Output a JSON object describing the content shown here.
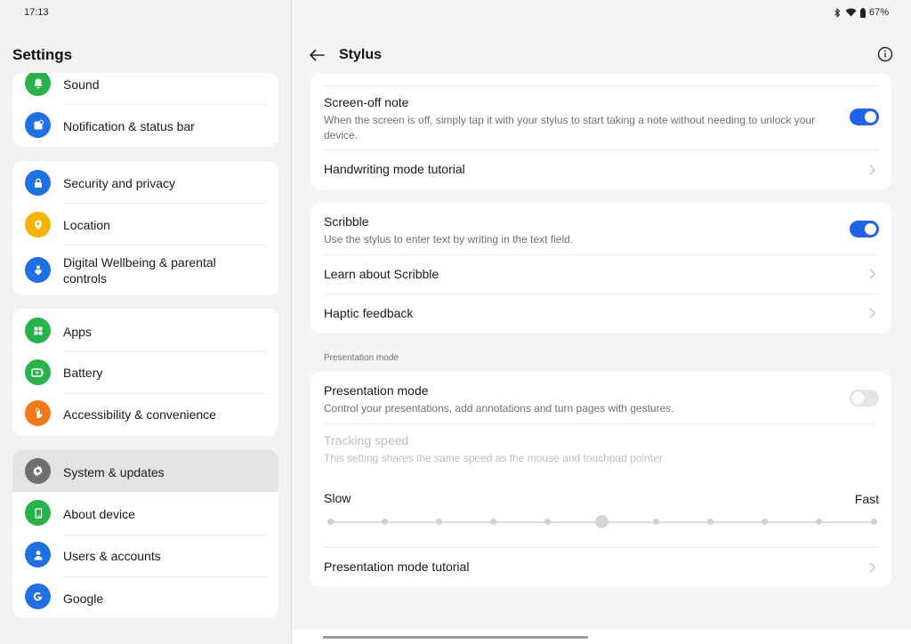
{
  "status_bar": {
    "time": "17:13",
    "battery": "67%"
  },
  "left": {
    "title": "Settings",
    "groups": [
      {
        "items": [
          {
            "label": "Sound",
            "icon": "bell-icon",
            "color": "#27b24a"
          },
          {
            "label": "Notification & status bar",
            "icon": "notification-icon",
            "color": "#1f6fe5"
          }
        ]
      },
      {
        "items": [
          {
            "label": "Security and privacy",
            "icon": "lock-icon",
            "color": "#1f6fe5"
          },
          {
            "label": "Location",
            "icon": "location-pin-icon",
            "color": "#f5b400"
          },
          {
            "label": "Digital Wellbeing & parental controls",
            "icon": "wellbeing-icon",
            "color": "#1f6fe5"
          }
        ]
      },
      {
        "items": [
          {
            "label": "Apps",
            "icon": "apps-grid-icon",
            "color": "#27b24a"
          },
          {
            "label": "Battery",
            "icon": "battery-icon",
            "color": "#27b24a"
          },
          {
            "label": "Accessibility & convenience",
            "icon": "hand-icon",
            "color": "#f07a1a"
          }
        ]
      },
      {
        "items": [
          {
            "label": "System & updates",
            "icon": "gear-icon",
            "color": "#6e6e6e",
            "selected": true
          },
          {
            "label": "About device",
            "icon": "device-icon",
            "color": "#27b24a"
          },
          {
            "label": "Users & accounts",
            "icon": "user-icon",
            "color": "#1f6fe5"
          },
          {
            "label": "Google",
            "icon": "google-icon",
            "color": "#1f6fe5"
          }
        ]
      }
    ]
  },
  "right": {
    "title": "Stylus",
    "screen_off_note": {
      "title": "Screen-off note",
      "subtitle": "When the screen is off, simply tap it with your stylus to start taking a note without needing to unlock your device.",
      "enabled": true
    },
    "handwriting_tutorial": "Handwriting mode tutorial",
    "scribble": {
      "title": "Scribble",
      "subtitle": "Use the stylus to enter text by writing in the text field.",
      "enabled": true
    },
    "learn_scribble": "Learn about Scribble",
    "haptic_feedback": "Haptic feedback",
    "section_presentation": "Presentation mode",
    "presentation_mode": {
      "title": "Presentation mode",
      "subtitle": "Control your presentations, add annotations and turn pages with gestures.",
      "enabled": false
    },
    "tracking_speed": {
      "title": "Tracking speed",
      "subtitle": "This setting shares the same speed as the mouse and touchpad pointer.",
      "slow_label": "Slow",
      "fast_label": "Fast",
      "steps": 11,
      "value_index": 5
    },
    "presentation_tutorial": "Presentation mode tutorial"
  },
  "colors": {
    "accent": "#1f63e8"
  }
}
